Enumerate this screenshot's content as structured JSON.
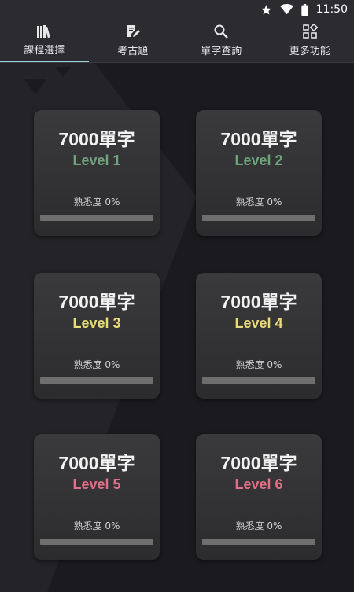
{
  "status_bar": {
    "time": "11:50",
    "icons": [
      "star-icon",
      "wifi-icon",
      "battery-icon"
    ]
  },
  "tabs": [
    {
      "label": "課程選擇",
      "icon": "books-icon",
      "active": true
    },
    {
      "label": "考古題",
      "icon": "edit-note-icon",
      "active": false
    },
    {
      "label": "單字查詢",
      "icon": "search-icon",
      "active": false
    },
    {
      "label": "更多功能",
      "icon": "apps-icon",
      "active": false
    }
  ],
  "accent_color": "#9ad0d8",
  "cards": [
    {
      "title": "7000單字",
      "level": "Level  1",
      "level_color": "#6fa37a",
      "familiarity": "熟悉度 0%"
    },
    {
      "title": "7000單字",
      "level": "Level  2",
      "level_color": "#6fa37a",
      "familiarity": "熟悉度 0%"
    },
    {
      "title": "7000單字",
      "level": "Level  3",
      "level_color": "#e9dc77",
      "familiarity": "熟悉度 0%"
    },
    {
      "title": "7000單字",
      "level": "Level  4",
      "level_color": "#e9dc77",
      "familiarity": "熟悉度 0%"
    },
    {
      "title": "7000單字",
      "level": "Level  5",
      "level_color": "#e07088",
      "familiarity": "熟悉度 0%"
    },
    {
      "title": "7000單字",
      "level": "Level  6",
      "level_color": "#e07088",
      "familiarity": "熟悉度 0%"
    }
  ]
}
